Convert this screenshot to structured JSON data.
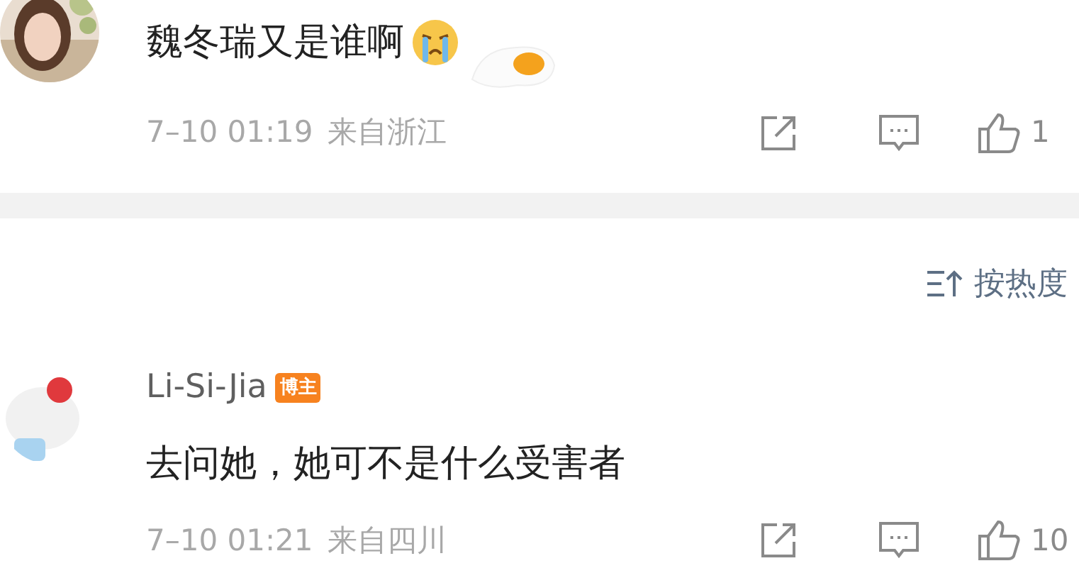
{
  "comments": [
    {
      "text": "魏冬瑞又是谁啊",
      "emoji": true,
      "time": "7–10 01:19",
      "location": "来自浙江",
      "likes": "1"
    },
    {
      "user": "Li-Si-Jia",
      "badge": "博主",
      "text": "去问她，她可不是什么受害者",
      "emoji": false,
      "time": "7–10 01:21",
      "location": "来自四川",
      "likes": "10"
    }
  ],
  "sort": {
    "label": "按热度"
  }
}
